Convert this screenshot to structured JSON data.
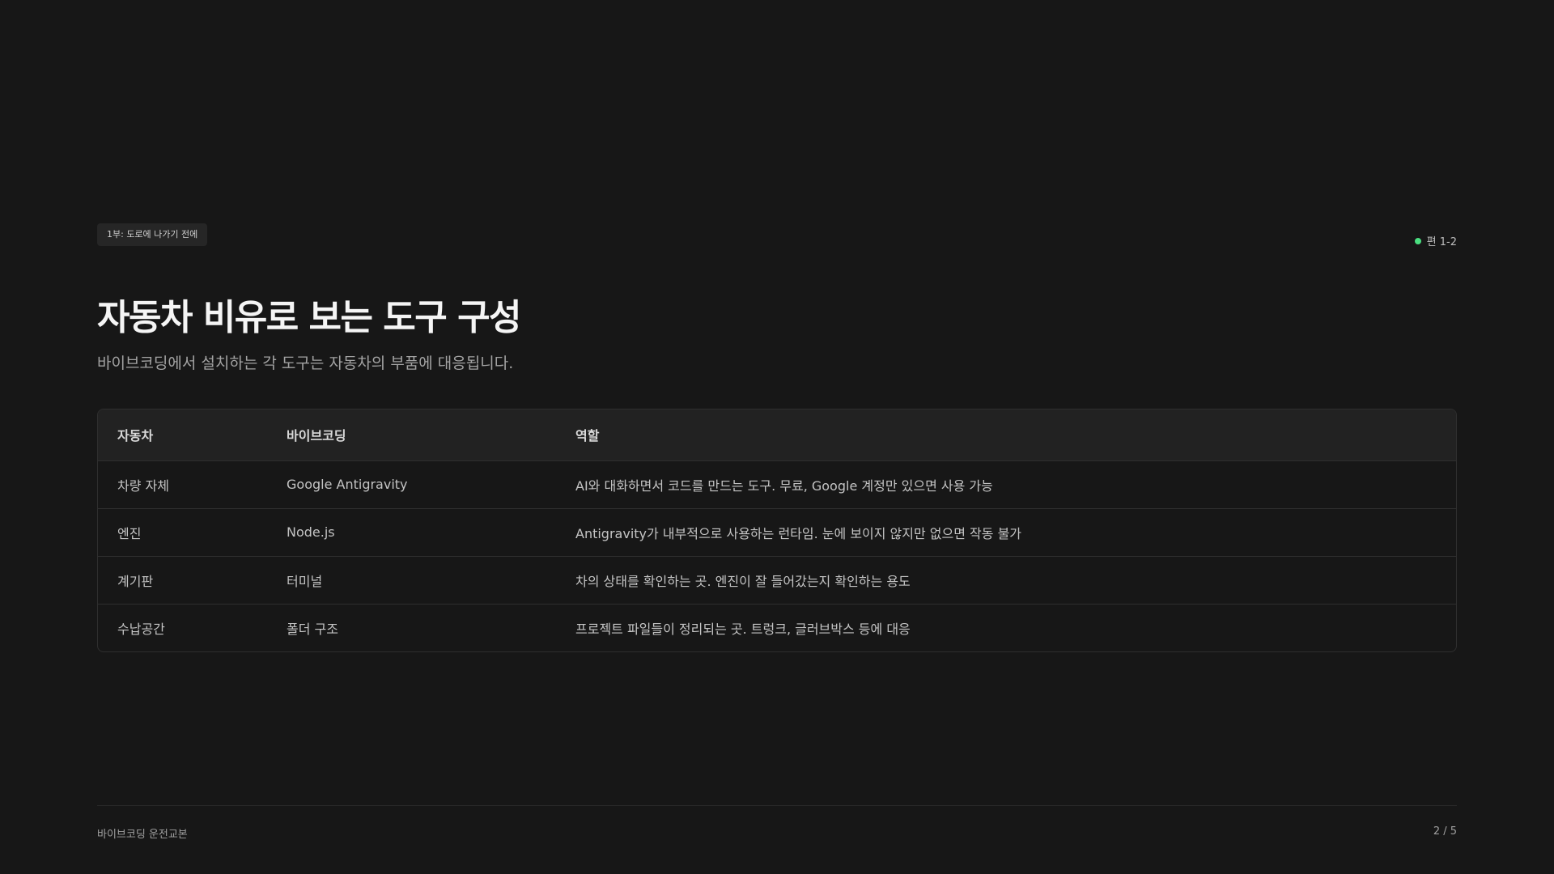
{
  "header": {
    "section_badge": "1부: 도로에 나가기 전에",
    "episode_label": "편 1-2",
    "episode_dot_color": "#4ade80"
  },
  "main": {
    "title": "자동차 비유로 보는 도구 구성",
    "subtitle": "바이브코딩에서 설치하는 각 도구는 자동차의 부품에 대응됩니다.",
    "table": {
      "headers": [
        "자동차",
        "바이브코딩",
        "역할"
      ],
      "rows": [
        [
          "차량 자체",
          "Google Antigravity",
          "AI와 대화하면서 코드를 만드는 도구. 무료, Google 계정만 있으면 사용 가능"
        ],
        [
          "엔진",
          "Node.js",
          "Antigravity가 내부적으로 사용하는 런타임. 눈에 보이지 않지만 없으면 작동 불가"
        ],
        [
          "계기판",
          "터미널",
          "차의 상태를 확인하는 곳. 엔진이 잘 들어갔는지 확인하는 용도"
        ],
        [
          "수납공간",
          "폴더 구조",
          "프로젝트 파일들이 정리되는 곳. 트렁크, 글러브박스 등에 대응"
        ]
      ]
    }
  },
  "footer": {
    "doc_title": "바이브코딩 운전교본",
    "page_indicator": "2 / 5"
  }
}
